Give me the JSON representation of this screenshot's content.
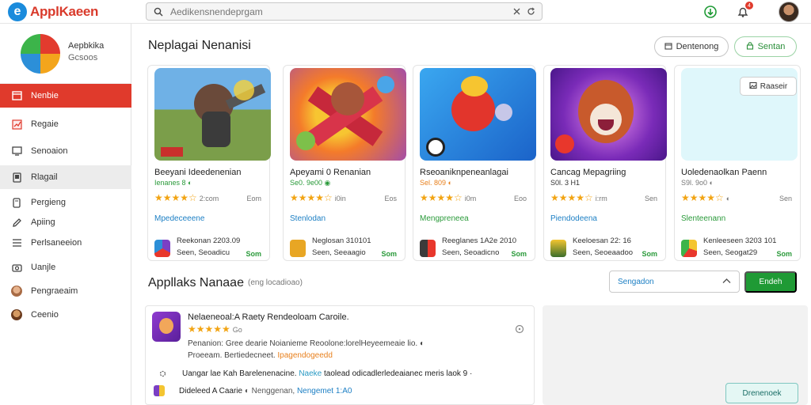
{
  "app": {
    "logo_letter": "e",
    "name": "ApplKaeen"
  },
  "search": {
    "placeholder": "Aedikensnendeprgam"
  },
  "topbar": {
    "notification_count": "4"
  },
  "profile": {
    "name": "Aepbkika",
    "sub": "Gcsoos"
  },
  "sidebar": {
    "items": [
      {
        "label": "Nenbie",
        "icon": "store-icon"
      },
      {
        "label": "Regaie",
        "icon": "chart-icon"
      },
      {
        "label": "Senoaion",
        "icon": "monitor-icon"
      },
      {
        "label": "Rlagail",
        "icon": "tablet-icon"
      },
      {
        "label": "Pergieng",
        "icon": "mobile-icon"
      },
      {
        "label": "Apiing",
        "icon": "pencil-icon"
      },
      {
        "label": "Perlsaneeion",
        "icon": "list-icon"
      },
      {
        "label": "Uanjle",
        "icon": "camera-icon"
      },
      {
        "label": "Pengraeaim",
        "icon": "avatar-icon"
      },
      {
        "label": "Ceenio",
        "icon": "avatar-icon"
      }
    ]
  },
  "featured": {
    "title": "Neplagai Nenanisi",
    "btn_left": "Dentenong",
    "btn_right": "Sentan",
    "cards": [
      {
        "title": "Beeyani Ideedenenian",
        "meta": "Ienanes 8  ◐",
        "rating": "★★★★☆",
        "rating_val": "2:com",
        "size": "Eom",
        "category": "Mpedeceeene",
        "category_color": "blue",
        "developer": "Reekonan 2203.09",
        "date": "Seen, Seoadicu",
        "price": "Som"
      },
      {
        "title": "Apeyami 0 Renanian",
        "meta": "Se0. 9e00  ◉",
        "rating": "★★★★☆",
        "rating_val": "i0in",
        "size": "Eos",
        "category": "Stenlodan",
        "category_color": "blue",
        "developer": "Neglosan 310101",
        "date": "Seen, Seeaagio",
        "price": "Som"
      },
      {
        "title": "Rseoaniknpeneanlagai",
        "meta": "Sel. 809  ◐",
        "rating": "★★★★☆",
        "rating_val": "i0m",
        "size": "Eoo",
        "category": "Mengpreneea",
        "category_color": "green",
        "developer": "Reeglanes 1A2e 2010",
        "date": "Seen, Seoadicno",
        "price": "Som"
      },
      {
        "title": "Cancag Mepagriing",
        "meta": "S0l. 3 H1",
        "rating": "★★★★☆",
        "rating_val": "i:rm",
        "size": "Sen",
        "category": "Piendodeena",
        "category_color": "blue",
        "developer": "Keeloesan 22: 16",
        "date": "Seen, Seoeaadoo",
        "price": "Som"
      },
      {
        "title": "Uoledenaolkan Paenn",
        "meta": "S9l. 9o0  ◐",
        "rating": "★★★★☆",
        "rating_val": "◐",
        "size": "Sen",
        "category": "Slenteenann",
        "category_color": "green",
        "developer": "Kenleeseen 3203 101",
        "date": "Seen, Seogat29",
        "price": "Som",
        "action": "Raaseir"
      }
    ]
  },
  "apps_section": {
    "title": "Appllaks Nanaae",
    "subtitle": "(eng locadioao)",
    "select_value": "Sengadon",
    "button": "Endeh",
    "list": {
      "title": "Nelaeneoal:A Raety Rendeoloam Caroile.",
      "rating": "★★★★★",
      "rating_val": "Go",
      "desc": "Penanion: Gree dearie Noianieme Reoolone:lorelHeyeemeaie lio. ◐",
      "prog_label": "Proeeam. Bertiedecneet.",
      "prog_highlight": "Ipagendogeedd",
      "row2_text": "Uangar lae Kah Barelenenacine.",
      "row2_tag": "Naeke",
      "row2_rest": "taolead odicadlerledeaianec meris laok  9  ·",
      "row3_text": "Dideleed A Caarie",
      "row3_tag": "Nenggenan",
      "row3_rest": "Nengemet 1:A0",
      "row3_mid": "◐ Nenggenan,"
    },
    "right_button": "Drenenoek"
  },
  "colors": {
    "accent_red": "#e03a2c",
    "accent_green": "#1f9a35",
    "link_blue": "#1c7fc4",
    "star": "#f2a413"
  }
}
